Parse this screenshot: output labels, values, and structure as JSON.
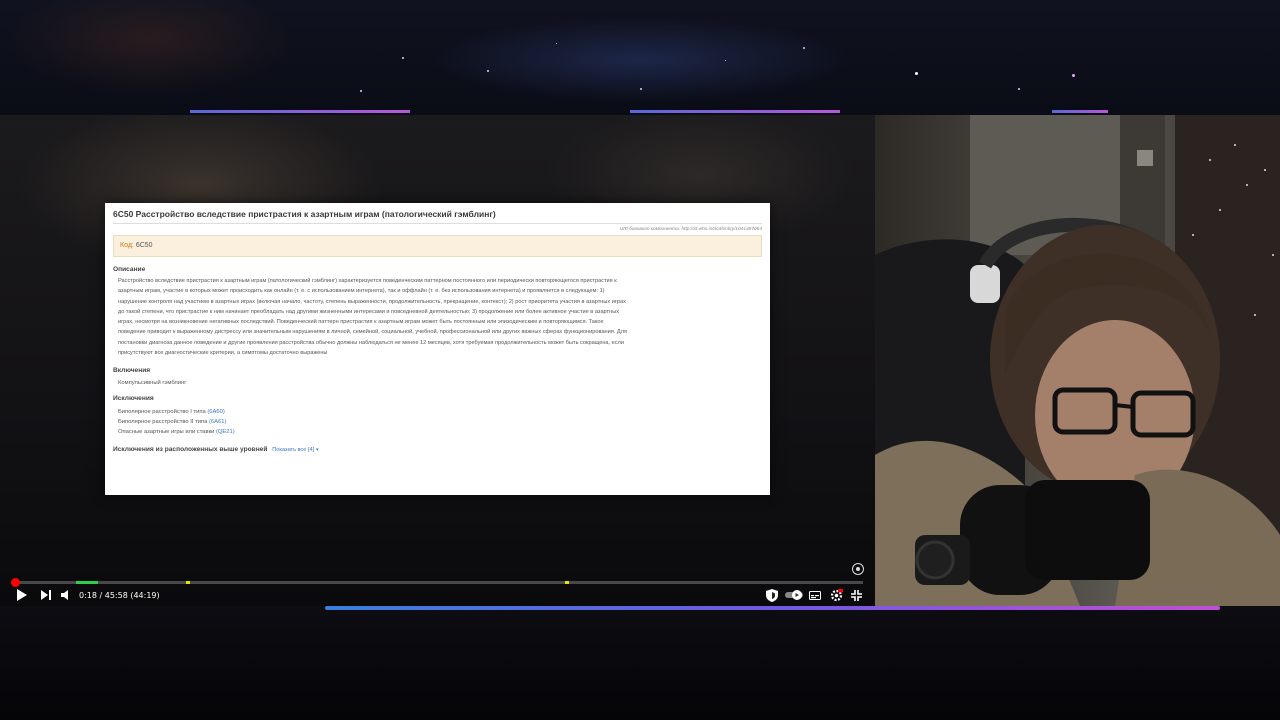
{
  "document": {
    "title": "6C50 Расстройство вследствие пристрастия к азартным играм (патологический гэмблинг)",
    "uri": "URI базового компонента: http://id.who.int/icd/entity/1041487064",
    "code_label": "Код:",
    "code_value": "6C50",
    "description_heading": "Описание",
    "description_lines": [
      "Расстройство вследствие пристрастия к азартным играм (патологический гэмблинг) характеризуется поведенческим паттерном постоянного или периодически повторяющегося пристрастия к",
      "азартным играм, участие в которых может происходить как онлайн (т. е. с использованием интернета), так и оффлайн (т. е. без использования интернета) и проявляется в следующем: 1)",
      "нарушение контроля над участием в азартных играх (включая начало, частоту, степень выраженности, продолжительность, прекращение, контекст); 2) рост приоритета участия в азартных играх",
      "до такой степени, что пристрастие к ним начинает преобладать над другими жизненными интересами и повседневной деятельностью; 3) продолжение или более активное участие в азартных",
      "играх, несмотря на возникновение негативных последствий. Поведенческий паттерн пристрастия к азартным играм может быть постоянным или эпизодическим и повторяющимся. Такое",
      "поведение приводит к выраженному дистрессу или значительным нарушениям в личной, семейной, социальной, учебной, профессиональной или других важных сферах функционирования. Для",
      "постановки диагноза данное поведение и другие проявления расстройства обычно должны наблюдаться не менее 12 месяцев, хотя требуемая продолжительность может быть сокращена, если",
      "присутствуют все диагностические критерии, а симптомы достаточно выражены"
    ],
    "inclusions_heading": "Включения",
    "inclusion_item": "Компульсивный гэмблинг",
    "exclusions_heading": "Исключения",
    "exclusions": [
      {
        "label": "Биполярное расстройство I типа",
        "code": "(6A60)"
      },
      {
        "label": "Биполярное расстройство II типа",
        "code": "(6A61)"
      },
      {
        "label": "Опасные азартные игры или ставки",
        "code": "(QE21)"
      }
    ],
    "parent_exclusions_heading": "Исключения из расположенных выше уровней",
    "show_all_label": "Показать все [4]"
  },
  "player": {
    "time_display": "0:18 / 45:58 (44:19)",
    "progress_fraction": 0.004,
    "icons": {
      "play": "play-icon",
      "next": "next-icon",
      "volume": "volume-icon",
      "shield": "shield-icon",
      "autoplay": "autoplay-toggle-icon",
      "subtitles": "subtitles-icon",
      "settings": "settings-icon",
      "fullscreen": "fullscreen-icon"
    },
    "accent_color": "#ff0000"
  }
}
